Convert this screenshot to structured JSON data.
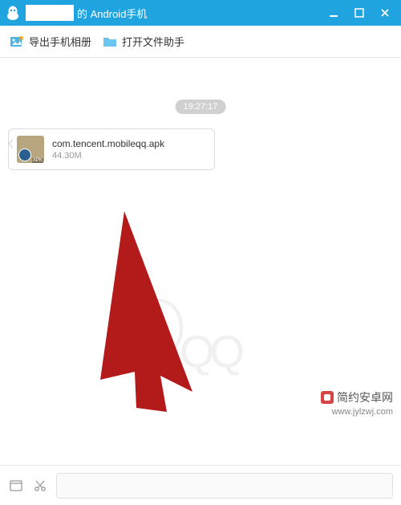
{
  "titlebar": {
    "title_suffix": "的 Android手机"
  },
  "toolbar": {
    "export_album_label": "导出手机相册",
    "open_file_helper_label": "打开文件助手"
  },
  "chat": {
    "timestamp": "19:27:17",
    "file_message": {
      "name": "com.tencent.mobileqq.apk",
      "size": "44.30M",
      "icon_label": "APK"
    }
  },
  "watermark": {
    "brand_text": "简约安卓网",
    "url_text": "www.jylzwj.com"
  }
}
